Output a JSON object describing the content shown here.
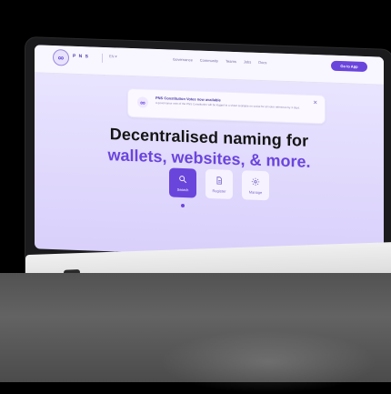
{
  "brand": {
    "text": "P N S",
    "icon": "chain-link-icon"
  },
  "nav": {
    "lang": "EN ▾",
    "links": [
      "Governance",
      "Community",
      "Teams",
      "Jobs",
      "Docs"
    ],
    "cta": "Go to App"
  },
  "banner": {
    "title": "PNS Constitution Votes now available",
    "body": "A governance vote of the PNS Constitution will be logged to a sheet available on social for all voter reference by 3 days."
  },
  "hero": {
    "line1": "Decentralised naming for",
    "line2": "wallets, websites, & more."
  },
  "cards": [
    {
      "label": "Search",
      "icon": "search-icon"
    },
    {
      "label": "Register",
      "icon": "document-icon"
    },
    {
      "label": "Manage",
      "icon": "settings-icon"
    }
  ],
  "colors": {
    "accent": "#6a45dc",
    "screenBg": "#d9d0fb"
  }
}
